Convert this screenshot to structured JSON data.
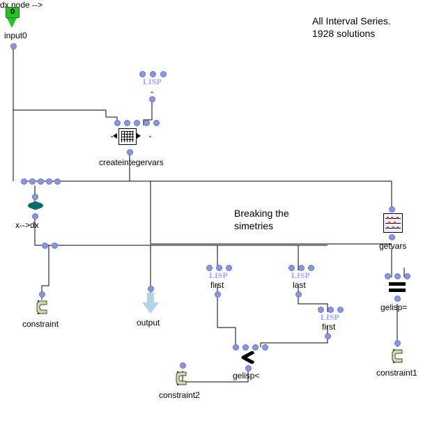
{
  "title": {
    "line1": "All Interval Series.",
    "line2": "1928 solutions"
  },
  "section": {
    "line1": "Breaking the",
    "line2": "simetries"
  },
  "input0": {
    "badge": "0",
    "label": "input0"
  },
  "lisp_minus": {
    "tag": "LISP",
    "op": "-"
  },
  "createintegervars": {
    "label": "createintegervars"
  },
  "xdx": {
    "label": "x-->dx"
  },
  "constraint": {
    "label": "constraint"
  },
  "output": {
    "label": "output"
  },
  "first1": {
    "tag": "LISP",
    "label": "first"
  },
  "last": {
    "tag": "LISP",
    "label": "last"
  },
  "first2": {
    "tag": "LISP",
    "label": "first"
  },
  "gelisp_lt": {
    "label": "gelisp<"
  },
  "constraint2": {
    "label": "constraint2"
  },
  "getvars": {
    "label": "getvars"
  },
  "gelisp_eq": {
    "label": "gelisp="
  },
  "constraint1": {
    "label": "constraint1"
  }
}
